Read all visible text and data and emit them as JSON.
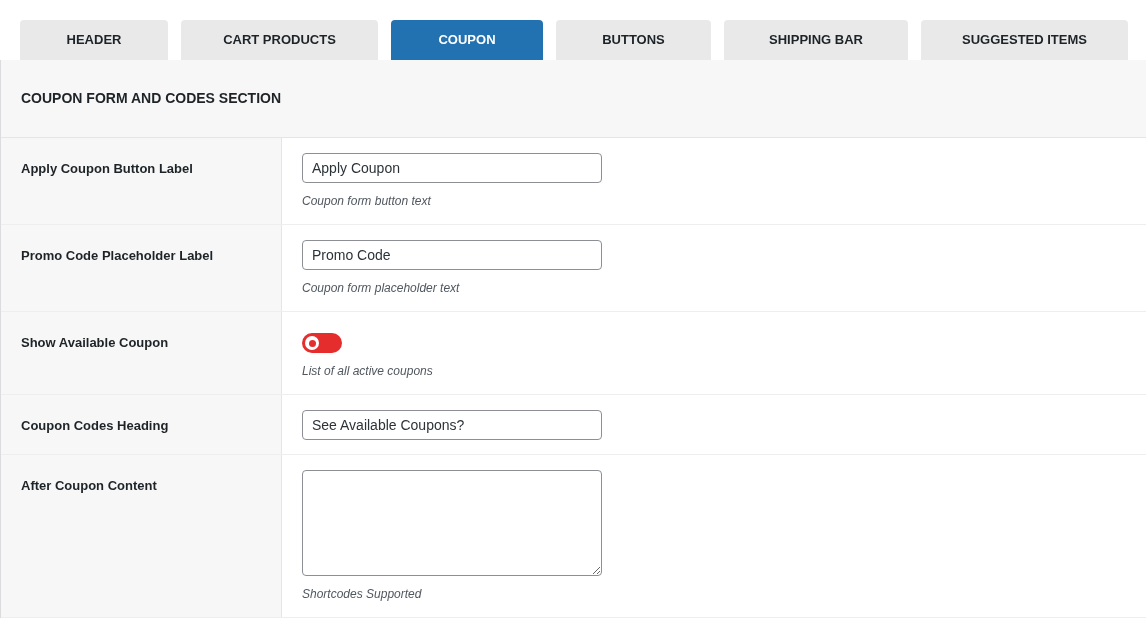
{
  "tabs": [
    {
      "label": "HEADER",
      "selected": false
    },
    {
      "label": "CART PRODUCTS",
      "selected": false
    },
    {
      "label": "COUPON",
      "selected": true
    },
    {
      "label": "BUTTONS",
      "selected": false
    },
    {
      "label": "SHIPPING BAR",
      "selected": false
    },
    {
      "label": "SUGGESTED ITEMS",
      "selected": false
    }
  ],
  "section": {
    "title": "COUPON FORM AND CODES SECTION"
  },
  "rows": [
    {
      "kind": "text",
      "label": "Apply Coupon Button Label",
      "value": "Apply Coupon",
      "description": "Coupon form button text"
    },
    {
      "kind": "text",
      "label": "Promo Code Placeholder Label",
      "value": "Promo Code",
      "description": "Coupon form placeholder text"
    },
    {
      "kind": "toggle",
      "label": "Show Available Coupon",
      "on": false,
      "description": "List of all active coupons"
    },
    {
      "kind": "text",
      "label": "Coupon Codes Heading",
      "value": "See Available Coupons?"
    },
    {
      "kind": "textarea",
      "label": "After Coupon Content",
      "description": "Shortcodes Supported"
    }
  ]
}
